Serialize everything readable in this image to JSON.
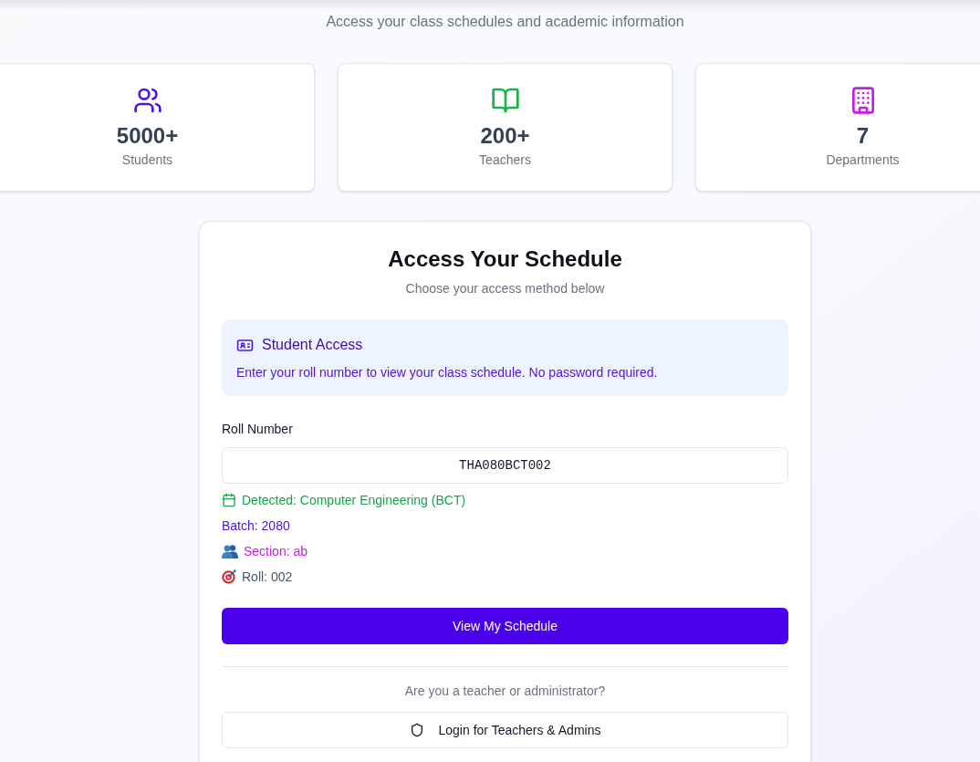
{
  "header": {
    "subtitle": "Access your class schedules and academic information"
  },
  "stats": [
    {
      "kind": "students",
      "value": "5000+",
      "label": "Students"
    },
    {
      "kind": "teachers",
      "value": "200+",
      "label": "Teachers"
    },
    {
      "kind": "departments",
      "value": "7",
      "label": "Departments"
    }
  ],
  "access_card": {
    "title": "Access Your Schedule",
    "subtitle": "Choose your access method below",
    "notice": {
      "title": "Student Access",
      "text": "Enter your roll number to view your class schedule. No password required."
    },
    "roll_field": {
      "label": "Roll Number",
      "value": "THA080BCT002"
    },
    "detected": [
      {
        "kind": "department",
        "text": "Detected: Computer Engineering (BCT)"
      },
      {
        "kind": "batch",
        "text": "Batch: 2080"
      },
      {
        "kind": "section",
        "text": "Section: ab"
      },
      {
        "kind": "roll",
        "text": "Roll: 002"
      }
    ],
    "submit_button": "View My Schedule",
    "staff_prompt": "Are you a teacher or administrator?",
    "staff_button": "Login for Teachers & Admins"
  }
}
